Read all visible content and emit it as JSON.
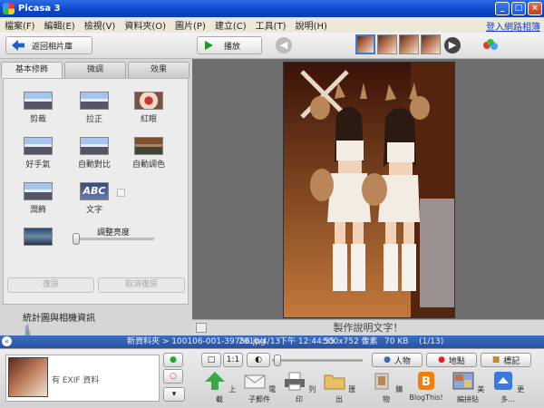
{
  "window": {
    "title": "Picasa 3"
  },
  "menu": {
    "items": [
      "檔案(F)",
      "編輯(E)",
      "檢視(V)",
      "資料夾(O)",
      "圖片(P)",
      "建立(C)",
      "工具(T)",
      "說明(H)"
    ],
    "signin": "登入網路相簿"
  },
  "toolbar": {
    "back_label": "返回相片庫",
    "play_label": "播放"
  },
  "tabs": [
    "基本修飾",
    "微調",
    "效果"
  ],
  "tools": [
    {
      "label": "剪裁"
    },
    {
      "label": "拉正"
    },
    {
      "label": "紅眼"
    },
    {
      "label": "好手氣"
    },
    {
      "label": "自動對比"
    },
    {
      "label": "自動調色"
    },
    {
      "label": "潤飾"
    },
    {
      "label": "文字"
    }
  ],
  "text_tool_badge": "ABC",
  "fill_light_label": "調整亮度",
  "undo_label": "復原",
  "redo_label": "取消復原",
  "stats_label": "統計圖與相機資訊",
  "exif_label": "有 EXIF 資料",
  "caption": "製作說明文字！",
  "info": {
    "path": "新資料夾 > 100106-001-39756.jpg",
    "date": "2010/4/13",
    "time": "下午 12:44:55",
    "size": "500x752 像素",
    "filesize": "70 KB",
    "index": "(1/13)"
  },
  "bottom": {
    "people": "人物",
    "places": "地點",
    "tags": "標記",
    "actions": [
      "上載",
      "電子郵件",
      "列印",
      "匯出",
      "購物",
      "BlogThis!",
      "美編拼貼",
      "更多..."
    ]
  },
  "colors": {
    "accent": "#2552a4",
    "titlebar": "#0a46c8",
    "viewer": "#6e6e6e"
  }
}
